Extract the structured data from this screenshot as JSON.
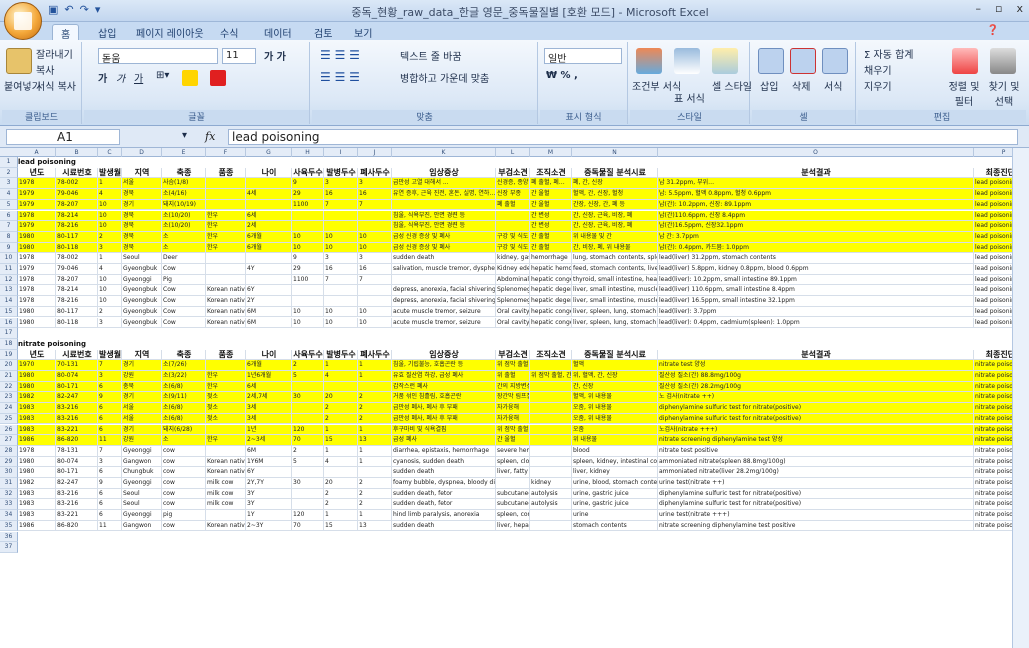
{
  "window": {
    "title": "중독_현황_raw_data_한글 영문_중독물질별 [호환 모드] - Microsoft Excel",
    "minimize": "–",
    "restore": "▫",
    "close": "x"
  },
  "ribbon": {
    "tabs": [
      "홈",
      "삽입",
      "페이지 레이아웃",
      "수식",
      "데이터",
      "검토",
      "보기"
    ],
    "clipboard": {
      "paste": "붙여넣기",
      "cut": "잘라내기",
      "copy": "복사",
      "format_painter": "서식 복사",
      "label": "클립보드"
    },
    "font": {
      "name": "돋움",
      "size": "11",
      "label": "글꼴"
    },
    "alignment": {
      "wrap": "텍스트 줄 바꿈",
      "merge": "병합하고 가운데 맞춤",
      "label": "맞춤"
    },
    "number": {
      "format": "일반",
      "label": "표시 형식"
    },
    "styles": {
      "conditional": "조건부 서식",
      "table": "표 서식",
      "cell": "셀 스타일",
      "label": "스타일"
    },
    "cells": {
      "insert": "삽입",
      "delete": "삭제",
      "format": "서식",
      "label": "셀"
    },
    "editing": {
      "autosum": "자동 합계",
      "fill": "채우기",
      "clear": "지우기",
      "sort": "정렬 및 필터",
      "find": "찾기 및 선택",
      "label": "편집"
    }
  },
  "formula_bar": {
    "name_box": "A1",
    "fx": "fx",
    "value": "lead poisoning"
  },
  "columns": [
    "A",
    "B",
    "C",
    "D",
    "E",
    "F",
    "G",
    "H",
    "I",
    "J",
    "K",
    "L",
    "M",
    "N",
    "O",
    "P"
  ],
  "headers": [
    "년도",
    "시료번호",
    "발생월",
    "지역",
    "축종",
    "품종",
    "나이",
    "사육두수",
    "발병두수",
    "폐사두수",
    "임상증상",
    "부검소견",
    "조직소견",
    "중독물질 분석시료",
    "분석결과",
    "최종진단명"
  ],
  "section1_title": "lead poisoning",
  "section2_title": "nitrate poisoning",
  "lead_rows": [
    {
      "n": "3",
      "y": true,
      "c": [
        "1978",
        "78-002",
        "1",
        "서울",
        "사슴(1/8)",
        "",
        "",
        "9",
        "3",
        "3",
        "급만성 고열 대해서 ...",
        "신경증, 종양",
        "폐 출혈, 폐…",
        "폐, 간, 신장",
        "납 31.2ppm, 부위…",
        "lead poisoning"
      ]
    },
    {
      "n": "4",
      "y": true,
      "c": [
        "1979",
        "79-046",
        "4",
        "경북",
        "소(4/16)",
        "",
        "4세",
        "29",
        "16",
        "16",
        "유연 증후, 근육 진전, 혼돈, 실명, 연하…",
        "신장 부종",
        "간 울혈",
        "혈액, 간, 신장, 혈청",
        "납: 5.5ppm, 혈액 0.8ppm, 혈청 0.6ppm",
        "lead poisoning"
      ]
    },
    {
      "n": "5",
      "y": true,
      "c": [
        "1979",
        "78-207",
        "10",
        "경기",
        "돼지(10/19)",
        "",
        "",
        "1100",
        "7",
        "7",
        "",
        "폐 출혈",
        "간 울혈",
        "간장, 신장, 간, 폐 등",
        "납(간): 10.2ppm, 신장: 89.1ppm",
        "lead poisoning"
      ]
    },
    {
      "n": "6",
      "y": true,
      "c": [
        "1978",
        "78-214",
        "10",
        "경북",
        "소(10/20)",
        "한우",
        "6세",
        "",
        "",
        "",
        "침울, 식욕부진, 안면 경련 등",
        "",
        "간 변성",
        "간, 신장, 근육, 비장, 폐",
        "납(간)110.6ppm, 신장 8.4ppm",
        "lead poisoning"
      ]
    },
    {
      "n": "7",
      "y": true,
      "c": [
        "1979",
        "78-216",
        "10",
        "경북",
        "소(10/20)",
        "한우",
        "2세",
        "",
        "",
        "",
        "침울, 식욕부진, 안면 경련 등",
        "",
        "간 변성",
        "간, 신장, 근육, 비장, 폐",
        "납(간)16.5ppm, 신장32.1ppm",
        "lead poisoning"
      ]
    },
    {
      "n": "8",
      "y": true,
      "c": [
        "1980",
        "80-117",
        "2",
        "경북",
        "소",
        "한우",
        "6개월",
        "10",
        "10",
        "10",
        "급성 신경 증상 및 폐사",
        "구강 및 식도",
        "간 출혈",
        "위 내용물 및 간",
        "납 간: 3.7ppm",
        "lead poisoning"
      ]
    },
    {
      "n": "9",
      "y": true,
      "c": [
        "1980",
        "80-118",
        "3",
        "경북",
        "소",
        "한우",
        "6개월",
        "10",
        "10",
        "10",
        "급성 신경 증상 및 폐사",
        "구강 및 식도",
        "간 출혈",
        "간, 비장, 폐, 위 내용물",
        "납(간): 0.4ppm, 카드뮴: 1.0ppm",
        "lead poisoning"
      ]
    },
    {
      "n": "10",
      "y": false,
      "c": [
        "1978",
        "78-002",
        "1",
        "Seoul",
        "Deer",
        "",
        "",
        "9",
        "3",
        "3",
        "sudden death",
        "kidney, gastric",
        "hemorrhage",
        "lung, stomach contents, spleen",
        "lead(liver) 31.2ppm, stomach contents",
        "lead poisoning"
      ]
    },
    {
      "n": "11",
      "y": false,
      "c": [
        "1979",
        "79-046",
        "4",
        "Gyeongbuk",
        "Cow",
        "",
        "4Y",
        "29",
        "16",
        "16",
        "salivation, muscle tremor, dysphea",
        "Kidney edema",
        "hepatic hemorrhage",
        "feed, stomach contents, liver, kidney",
        "lead(liver) 5.8ppm, kidney 0.8ppm, blood 0.6ppm",
        "lead poisoning"
      ]
    },
    {
      "n": "12",
      "y": false,
      "c": [
        "1978",
        "78-207",
        "10",
        "Gyeonggi",
        "Pig",
        "",
        "",
        "1100",
        "7",
        "7",
        "",
        "Abdominal",
        "hepatic congestion",
        "thyroid, small intestine, heart, kidney",
        "lead(liver): 10.2ppm, small intestine 89.1ppm",
        "lead poisoning"
      ]
    },
    {
      "n": "13",
      "y": false,
      "c": [
        "1978",
        "78-214",
        "10",
        "Gyeongbuk",
        "Cow",
        "Korean native",
        "6Y",
        "",
        "",
        "",
        "depress, anorexia, facial shivering",
        "Splenomegaly",
        "hepatic degeneration",
        "liver, small intestine, muscle, spleen",
        "lead(liver) 110.6ppm, small intestine 8.4ppm",
        "lead poisoning"
      ]
    },
    {
      "n": "14",
      "y": false,
      "c": [
        "1978",
        "78-216",
        "10",
        "Gyeongbuk",
        "Cow",
        "Korean native",
        "2Y",
        "",
        "",
        "",
        "depress, anorexia, facial shivering",
        "Splenomegaly",
        "hepatic degeneration",
        "liver, small intestine, muscle, spleen",
        "lead(liver) 16.5ppm, small intestine 32.1ppm",
        "lead poisoning"
      ]
    },
    {
      "n": "15",
      "y": false,
      "c": [
        "1980",
        "80-117",
        "2",
        "Gyeongbuk",
        "Cow",
        "Korean native",
        "6M",
        "10",
        "10",
        "10",
        "acute muscle tremor, seizure",
        "Oral cavity",
        "hepatic congestion",
        "liver, spleen, lung, stomach contents",
        "lead(liver): 3.7ppm",
        "lead poisoning"
      ]
    },
    {
      "n": "16",
      "y": false,
      "c": [
        "1980",
        "80-118",
        "3",
        "Gyeongbuk",
        "Cow",
        "Korean native",
        "6M",
        "10",
        "10",
        "10",
        "acute muscle tremor, seizure",
        "Oral cavity",
        "hepatic congestion",
        "liver, spleen, lung, stomach contents",
        "lead(liver): 0.4ppm, cadmium(spleen): 1.0ppm",
        "lead poisoning"
      ]
    }
  ],
  "nitrate_rows": [
    {
      "n": "20",
      "y": true,
      "c": [
        "1970",
        "70-131",
        "7",
        "경기",
        "소(7/26)",
        "",
        "6개월",
        "2",
        "1",
        "1",
        "침울, 기립불능, 호흡곤란 등",
        "위 점막 출혈",
        "",
        "혈액",
        "nitrate test 양성",
        "nitrate poisoning"
      ]
    },
    {
      "n": "21",
      "y": true,
      "c": [
        "1980",
        "80-074",
        "3",
        "강원",
        "소(3/22)",
        "한우",
        "1년6개월",
        "5",
        "4",
        "1",
        "유효 질산염 하강, 급성 폐사",
        "위 출혈",
        "위 점막 출혈, 간 울혈",
        "위, 혈액, 간, 신장",
        "질산성 질소(간) 88.8mg/100g",
        "nitrate poisoning"
      ]
    },
    {
      "n": "22",
      "y": true,
      "c": [
        "1980",
        "80-171",
        "6",
        "충북",
        "소(6/8)",
        "한우",
        "6세",
        "",
        "",
        "",
        "갑작스런 폐사",
        "간의 지방변성",
        "",
        "간, 신장",
        "질산성 질소(간) 28.2mg/100g",
        "nitrate poisoning"
      ]
    },
    {
      "n": "23",
      "y": true,
      "c": [
        "1982",
        "82-247",
        "9",
        "경기",
        "소(9/11)",
        "젖소",
        "2세,7세",
        "30",
        "20",
        "2",
        "거품 섞인 침흘림, 호흡곤란",
        "장간막 림프절",
        "",
        "혈액, 위 내용물",
        "노 검사(nitrate ++)",
        "nitrate poisoning"
      ]
    },
    {
      "n": "24",
      "y": true,
      "c": [
        "1983",
        "83-216",
        "6",
        "서울",
        "소(6/8)",
        "젖소",
        "3세",
        "",
        "2",
        "2",
        "급만성 폐사, 폐사 후 부패",
        "자가융해",
        "",
        "오줌, 위 내용물",
        "diphenylamine sulfuric test for nitrate(positive)",
        "nitrate poisoning"
      ]
    },
    {
      "n": "25",
      "y": true,
      "c": [
        "1983",
        "83-216",
        "6",
        "서울",
        "소(6/8)",
        "젖소",
        "3세",
        "",
        "2",
        "2",
        "급만성 폐사, 폐사 후 부패",
        "자가융해",
        "",
        "오줌, 위 내용물",
        "diphenylamine sulfuric test for nitrate(positive)",
        "nitrate poisoning"
      ]
    },
    {
      "n": "26",
      "y": true,
      "c": [
        "1983",
        "83-221",
        "6",
        "경기",
        "돼지(6/28)",
        "",
        "1년",
        "120",
        "1",
        "1",
        "후구마비 및 식욕결핍",
        "위 점막 출혈",
        "",
        "오줌",
        "노검사(nitrate +++)",
        "nitrate poisoning"
      ]
    },
    {
      "n": "27",
      "y": true,
      "c": [
        "1986",
        "86-820",
        "11",
        "강원",
        "소",
        "한우",
        "2~3세",
        "70",
        "15",
        "13",
        "급성 폐사",
        "간 울혈",
        "",
        "위 내용물",
        "nitrate screening diphenylamine test 양성",
        "nitrate poisoning"
      ]
    },
    {
      "n": "28",
      "y": false,
      "c": [
        "1978",
        "78-131",
        "7",
        "Gyeonggi",
        "cow",
        "",
        "6M",
        "2",
        "1",
        "1",
        "diarrhea, epistaxis, hemorrhage",
        "severe hemorrhage",
        "",
        "blood",
        "nitrate test positive",
        "nitrate poisoning"
      ]
    },
    {
      "n": "29",
      "y": false,
      "c": [
        "1980",
        "80-074",
        "3",
        "Gangwon",
        "cow",
        "Korean native",
        "1Y6M",
        "5",
        "4",
        "1",
        "cyanosis, sudden death",
        "spleen, cloudy and fragile",
        "",
        "spleen, kidney, intestinal contents",
        "ammoniated nitrate(spleen 88.8mg/100g)",
        "nitrate poisoning"
      ]
    },
    {
      "n": "30",
      "y": false,
      "c": [
        "1980",
        "80-171",
        "6",
        "Chungbuk",
        "cow",
        "Korean native",
        "6Y",
        "",
        "",
        "",
        "sudden death",
        "liver, fatty change",
        "",
        "liver, kidney",
        "ammoniated nitrate(liver 28.2mg/100g)",
        "nitrate poisoning"
      ]
    },
    {
      "n": "31",
      "y": false,
      "c": [
        "1982",
        "82-247",
        "9",
        "Gyeonggi",
        "cow",
        "milk cow",
        "2Y,7Y",
        "30",
        "20",
        "2",
        "foamy bubble, dyspnea, bloody diarrhea",
        "",
        "kidney",
        "urine, blood, stomach contents",
        "urine test(nitrate ++)",
        "nitrate poisoning"
      ]
    },
    {
      "n": "32",
      "y": false,
      "c": [
        "1983",
        "83-216",
        "6",
        "Seoul",
        "cow",
        "milk cow",
        "3Y",
        "",
        "2",
        "2",
        "sudden death, fetor",
        "subcutaneous",
        "autolysis",
        "urine, gastric juice",
        "diphenylamine sulfuric test for nitrate(positive)",
        "nitrate poisoning"
      ]
    },
    {
      "n": "33",
      "y": false,
      "c": [
        "1983",
        "83-216",
        "6",
        "Seoul",
        "cow",
        "milk cow",
        "3Y",
        "",
        "2",
        "2",
        "sudden death, fetor",
        "subcutaneous",
        "autolysis",
        "urine, gastric juice",
        "diphenylamine sulfuric test for nitrate(positive)",
        "nitrate poisoning"
      ]
    },
    {
      "n": "34",
      "y": false,
      "c": [
        "1983",
        "83-221",
        "6",
        "Gyeonggi",
        "pig",
        "",
        "1Y",
        "120",
        "1",
        "1",
        "hind limb paralysis, anorexia",
        "spleen, congestion",
        "",
        "urine",
        "urine test(nitrate +++)",
        "nitrate poisoning"
      ]
    },
    {
      "n": "35",
      "y": false,
      "c": [
        "1986",
        "86-820",
        "11",
        "Gangwon",
        "cow",
        "Korean native",
        "2~3Y",
        "70",
        "15",
        "13",
        "sudden death",
        "liver, hepatic congestion",
        "",
        "stomach contents",
        "nitrate screening diphenylamine test positive",
        "nitrate poisoning"
      ]
    }
  ],
  "empty_rows": [
    "17",
    "18",
    "36",
    "37"
  ]
}
